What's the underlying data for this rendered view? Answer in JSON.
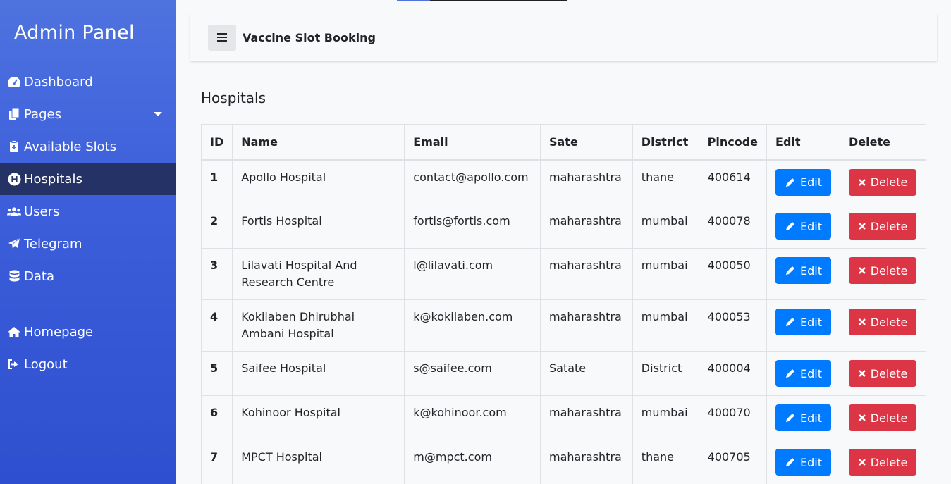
{
  "sidebar": {
    "brand": "Admin Panel",
    "items": [
      {
        "label": "Dashboard",
        "icon": "tachometer-icon"
      },
      {
        "label": "Pages",
        "icon": "copy-icon"
      },
      {
        "label": "Available Slots",
        "icon": "clipboard-icon"
      },
      {
        "label": "Hospitals",
        "icon": "hospital-icon",
        "active": true
      },
      {
        "label": "Users",
        "icon": "users-icon"
      },
      {
        "label": "Telegram",
        "icon": "paper-plane-icon"
      },
      {
        "label": "Data",
        "icon": "database-icon"
      },
      {
        "label": "Homepage",
        "icon": "home-icon"
      },
      {
        "label": "Logout",
        "icon": "sign-out-icon"
      }
    ]
  },
  "topbar": {
    "title": "Vaccine Slot Booking"
  },
  "page": {
    "title": "Hospitals"
  },
  "table": {
    "headers": [
      "ID",
      "Name",
      "Email",
      "Sate",
      "District",
      "Pincode",
      "Edit",
      "Delete"
    ],
    "edit_label": "Edit",
    "delete_label": "Delete",
    "rows": [
      {
        "id": "1",
        "name": "Apollo Hospital",
        "email": "contact@apollo.com",
        "state": "maharashtra",
        "district": "thane",
        "pincode": "400614"
      },
      {
        "id": "2",
        "name": "Fortis Hospital",
        "email": "fortis@fortis.com",
        "state": "maharashtra",
        "district": "mumbai",
        "pincode": "400078"
      },
      {
        "id": "3",
        "name": "Lilavati Hospital And Research Centre",
        "email": "l@lilavati.com",
        "state": "maharashtra",
        "district": "mumbai",
        "pincode": "400050"
      },
      {
        "id": "4",
        "name": "Kokilaben Dhirubhai Ambani Hospital",
        "email": "k@kokilaben.com",
        "state": "maharashtra",
        "district": "mumbai",
        "pincode": "400053"
      },
      {
        "id": "5",
        "name": "Saifee Hospital",
        "email": "s@saifee.com",
        "state": "Satate",
        "district": "District",
        "pincode": "400004"
      },
      {
        "id": "6",
        "name": "Kohinoor Hospital",
        "email": "k@kohinoor.com",
        "state": "maharashtra",
        "district": "mumbai",
        "pincode": "400070"
      },
      {
        "id": "7",
        "name": "MPCT Hospital",
        "email": "m@mpct.com",
        "state": "maharashtra",
        "district": "thane",
        "pincode": "400705"
      }
    ]
  },
  "colors": {
    "primary": "#007bff",
    "danger": "#dc3545",
    "sidebar": "#4e73df",
    "active": "#253266"
  }
}
